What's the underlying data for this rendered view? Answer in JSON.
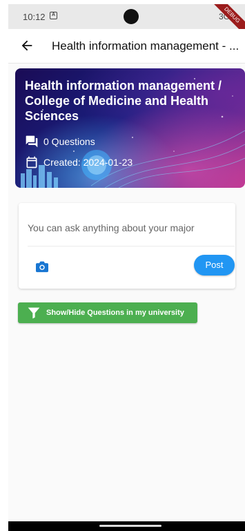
{
  "status_bar": {
    "time": "10:12",
    "notification_glyph": "A",
    "network": "3G",
    "debug_banner": "DEBUG"
  },
  "app_bar": {
    "back_icon": "arrow-back-icon",
    "title": "Health information management - ..."
  },
  "banner": {
    "title": "Health information management / College of Medicine and Health Sciences",
    "questions_text": "0 Questions",
    "created_text": "Created: 2024-01-23"
  },
  "ask_card": {
    "prompt": "You can ask anything about your major",
    "camera_icon": "camera-icon",
    "post_label": "Post"
  },
  "filter_button": {
    "label": "Show/Hide Questions in my university",
    "icon": "filter-icon"
  },
  "colors": {
    "accent_blue": "#2196f3",
    "accent_green": "#4caf50"
  }
}
